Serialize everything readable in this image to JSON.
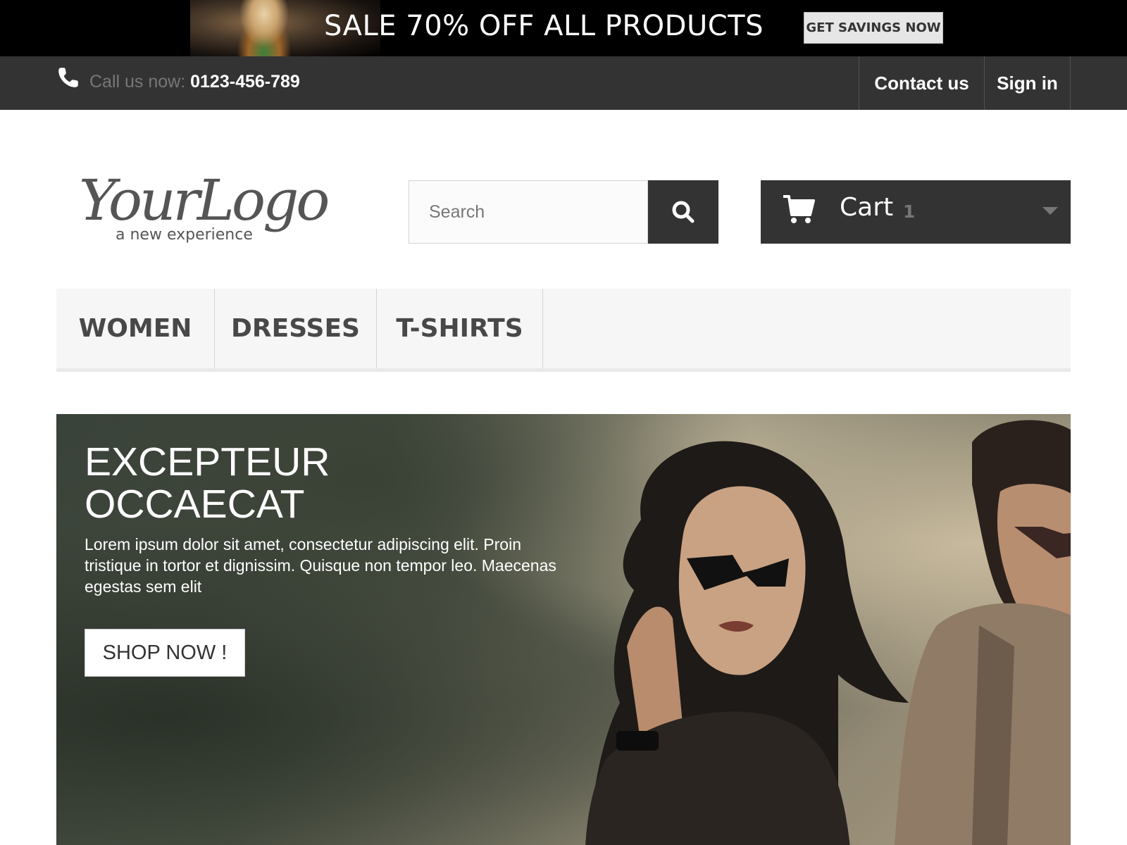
{
  "promo": {
    "text": "SALE 70% OFF ALL PRODUCTS",
    "button": "GET SAVINGS NOW"
  },
  "topbar": {
    "call_label": "Call us now: ",
    "phone": "0123-456-789",
    "links": [
      "Contact us",
      "Sign in"
    ]
  },
  "header": {
    "logo_text": "YourLogo",
    "logo_tagline": "a new experience",
    "search_placeholder": "Search",
    "cart_label": "Cart",
    "cart_count": "1"
  },
  "menu": {
    "items": [
      "WOMEN",
      "DRESSES",
      "T-SHIRTS"
    ]
  },
  "hero": {
    "title": "EXCEPTEUR OCCAECAT",
    "text": "Lorem ipsum dolor sit amet, consectetur adipiscing elit. Proin tristique in tortor et dignissim. Quisque non tempor leo. Maecenas egestas sem elit",
    "button": "SHOP NOW !"
  },
  "colors": {
    "dark": "#333333",
    "menu_bg": "#f6f6f6",
    "menu_text": "#484848",
    "muted": "#777777"
  },
  "icons": [
    "phone-icon",
    "search-icon",
    "cart-icon",
    "caret-down-icon"
  ]
}
